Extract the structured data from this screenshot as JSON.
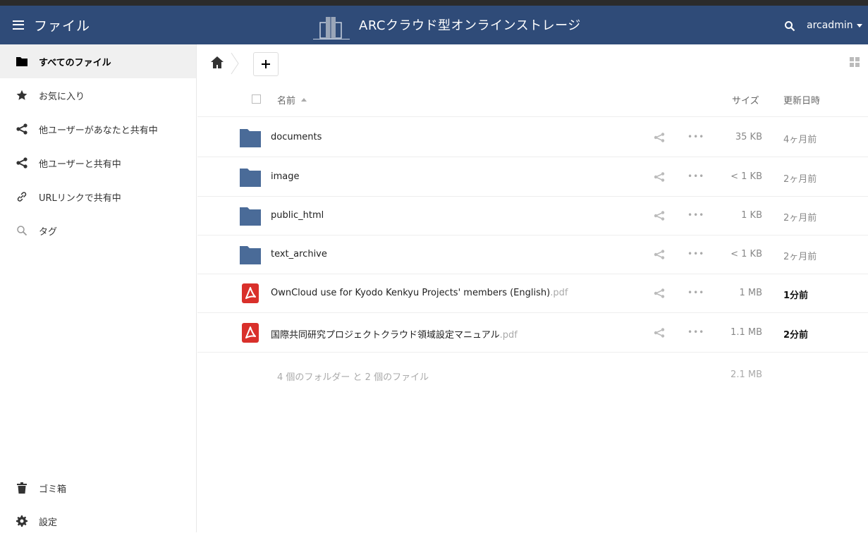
{
  "header": {
    "menu_label": "ファイル",
    "app_title": "ARCクラウド型オンラインストレージ",
    "user_name": "arcadmin"
  },
  "sidebar": {
    "items": [
      {
        "label": "すべてのファイル",
        "icon": "folder-icon"
      },
      {
        "label": "お気に入り",
        "icon": "star-icon"
      },
      {
        "label": "他ユーザーがあなたと共有中",
        "icon": "share-icon"
      },
      {
        "label": "他ユーザーと共有中",
        "icon": "share-icon"
      },
      {
        "label": "URLリンクで共有中",
        "icon": "link-icon"
      },
      {
        "label": "タグ",
        "icon": "tag-search-icon"
      }
    ],
    "trash_label": "ゴミ箱",
    "settings_label": "設定"
  },
  "table": {
    "col_name": "名前",
    "col_size": "サイズ",
    "col_modified": "更新日時"
  },
  "files": [
    {
      "name": "documents",
      "ext": "",
      "type": "folder",
      "size": "35 KB",
      "modified": "4ヶ月前",
      "recent": false
    },
    {
      "name": "image",
      "ext": "",
      "type": "folder",
      "size": "< 1 KB",
      "modified": "2ヶ月前",
      "recent": false
    },
    {
      "name": "public_html",
      "ext": "",
      "type": "folder",
      "size": "1 KB",
      "modified": "2ヶ月前",
      "recent": false
    },
    {
      "name": "text_archive",
      "ext": "",
      "type": "folder",
      "size": "< 1 KB",
      "modified": "2ヶ月前",
      "recent": false
    },
    {
      "name": "OwnCloud use for Kyodo Kenkyu Projects' members (English)",
      "ext": ".pdf",
      "type": "pdf",
      "size": "1 MB",
      "modified": "1分前",
      "recent": true
    },
    {
      "name": "国際共同研究プロジェクトクラウド領域設定マニュアル",
      "ext": ".pdf",
      "type": "pdf",
      "size": "1.1 MB",
      "modified": "2分前",
      "recent": true
    }
  ],
  "summary": {
    "text": "4 個のフォルダー と 2 個のファイル",
    "total_size": "2.1 MB"
  },
  "colors": {
    "header_bg": "#2f4b78",
    "folder": "#4a6b98",
    "pdf": "#d9302b"
  }
}
